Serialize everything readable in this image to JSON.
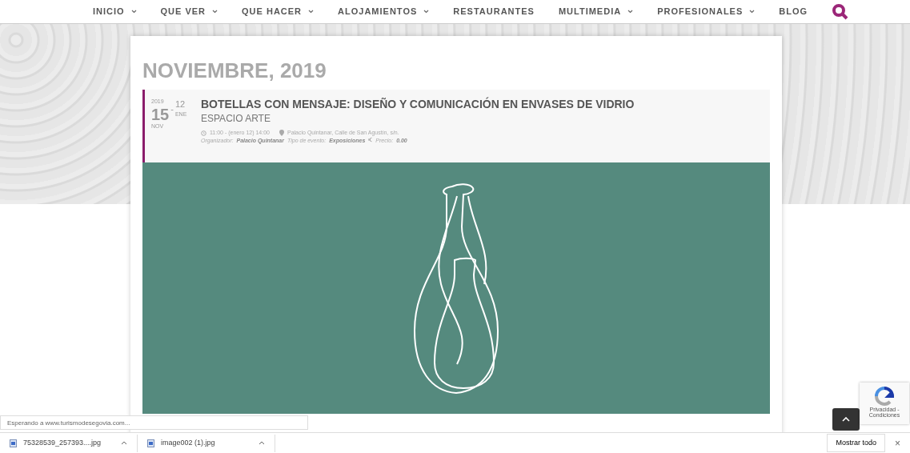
{
  "nav": {
    "items": [
      {
        "label": "INICIO",
        "dropdown": true
      },
      {
        "label": "QUE VER",
        "dropdown": true
      },
      {
        "label": "QUE HACER",
        "dropdown": true
      },
      {
        "label": "ALOJAMIENTOS",
        "dropdown": true
      },
      {
        "label": "RESTAURANTES",
        "dropdown": false
      },
      {
        "label": "MULTIMEDIA",
        "dropdown": true
      },
      {
        "label": "PROFESIONALES",
        "dropdown": true
      },
      {
        "label": "BLOG",
        "dropdown": false
      }
    ]
  },
  "month_heading": "NOVIEMBRE, 2019",
  "event": {
    "start_year": "2019",
    "start_day": "15",
    "start_month": "NOV",
    "range_separator": "-",
    "end_day": "12",
    "end_month": "ENE",
    "title": "BOTELLAS CON MENSAJE: DISEÑO Y COMUNICACIÓN EN ENVASES DE VIDRIO",
    "subtitle": "ESPACIO ARTE",
    "time": "11:00 - (enero 12) 14:00",
    "location": "Palacio Quintanar, Calle de San Agustín, s/n.",
    "organizer_label": "Organizador:",
    "organizer": "Palacio Quintanar",
    "type_label": "Tipo de evento:",
    "type": "Exposiciones",
    "price_label": "Precio:",
    "price": "0.00"
  },
  "status_text": "Esperando a www.turismodesegovia.com...",
  "recaptcha_text": "Privacidad - Condiciones",
  "downloads": {
    "items": [
      {
        "name": "75328539_257393....jpg"
      },
      {
        "name": "image002 (1).jpg"
      }
    ],
    "show_all": "Mostrar todo",
    "close": "×"
  }
}
